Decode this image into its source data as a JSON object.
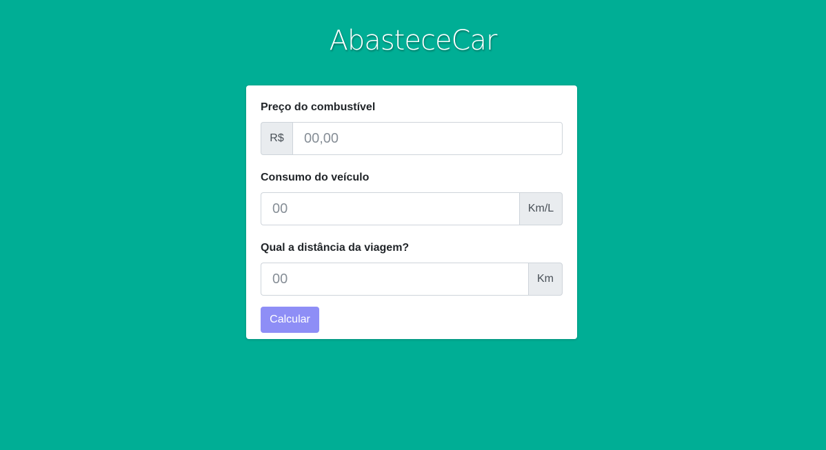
{
  "brand": {
    "title": "AbasteceCar"
  },
  "form": {
    "price": {
      "label": "Preço do combustível",
      "prefix": "R$",
      "placeholder": "00,00",
      "value": ""
    },
    "consumption": {
      "label": "Consumo do veículo",
      "suffix": "Km/L",
      "placeholder": "00",
      "value": ""
    },
    "distance": {
      "label": "Qual a distância da viagem?",
      "suffix": "Km",
      "placeholder": "00",
      "value": ""
    },
    "submit_label": "Calcular"
  },
  "colors": {
    "background": "#00ae95",
    "card": "#ffffff",
    "button": "#8e8ef6",
    "addon": "#e9ecef"
  }
}
